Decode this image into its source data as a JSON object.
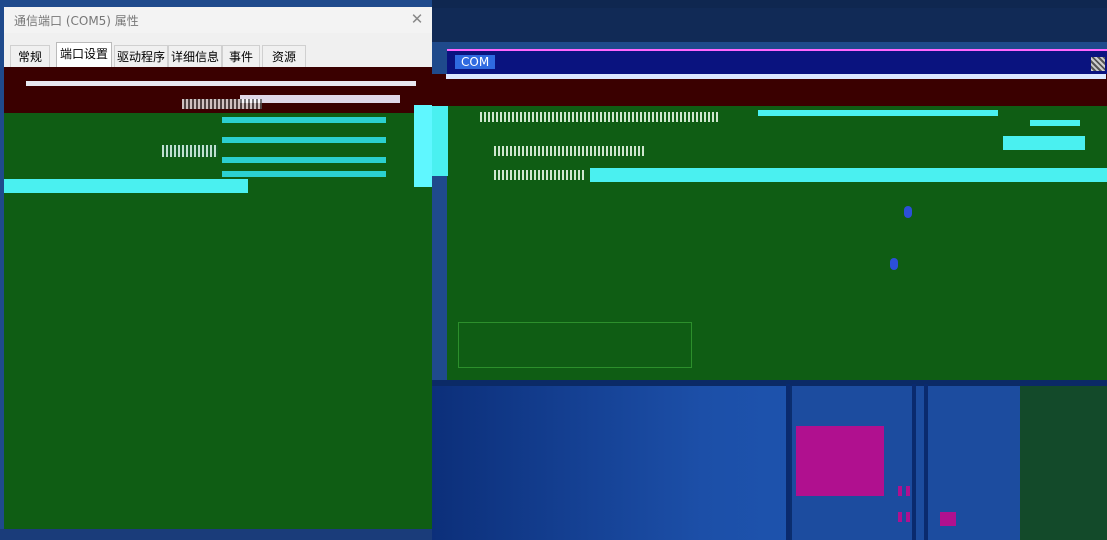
{
  "dialog": {
    "title": "通信端口 (COM5) 属性",
    "close_glyph": "✕",
    "tabs": [
      {
        "label": "常规",
        "active": false
      },
      {
        "label": "端口设置",
        "active": true
      },
      {
        "label": "驱动程序",
        "active": false
      },
      {
        "label": "详细信息",
        "active": false
      },
      {
        "label": "事件",
        "active": false
      },
      {
        "label": "资源",
        "active": false
      }
    ]
  },
  "right_window": {
    "title": "COM"
  },
  "colors": {
    "dialog_body": "#0f5d14",
    "band": "#3a0000",
    "accent_cyan": "#4af0f0",
    "title_bar_blue": "#0a137f",
    "magenta": "#b0108f"
  }
}
